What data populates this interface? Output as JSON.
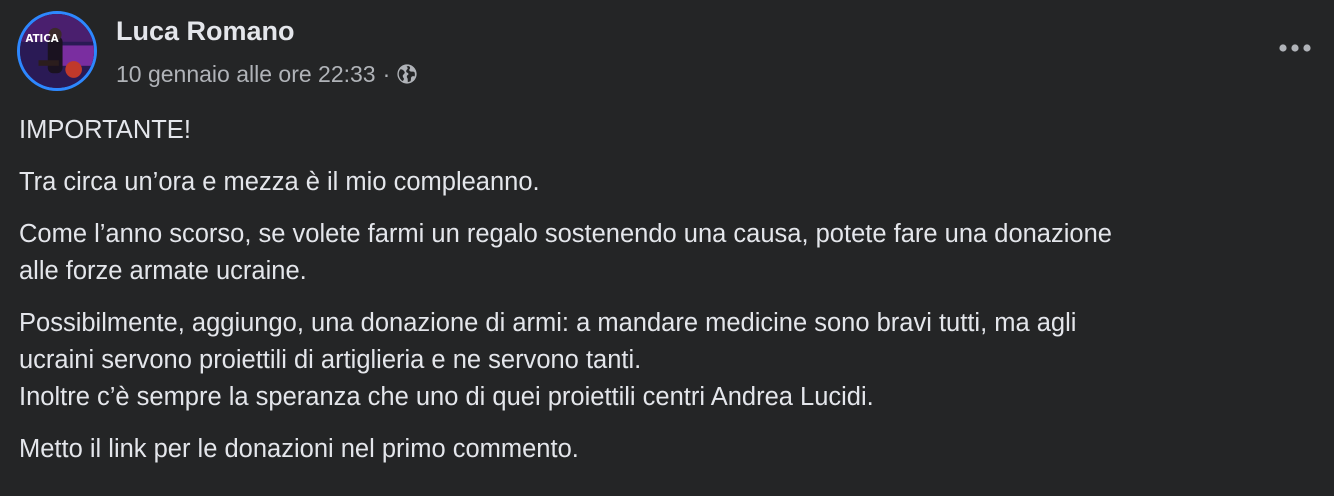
{
  "post": {
    "author_name": "Luca Romano",
    "timestamp": "10 gennaio alle ore 22:33",
    "separator": "·",
    "privacy_icon": "globe-icon",
    "more_icon": "more-options-icon",
    "avatar_text": "ATICA",
    "paragraphs": [
      {
        "lines": [
          "IMPORTANTE!"
        ]
      },
      {
        "lines": [
          "Tra circa un’ora e mezza è il mio compleanno."
        ]
      },
      {
        "lines": [
          "Come l’anno scorso, se volete farmi un regalo sostenendo una causa, potete fare una donazione",
          "alle forze armate ucraine."
        ]
      },
      {
        "lines": [
          "Possibilmente, aggiungo, una donazione di armi: a mandare medicine sono bravi tutti, ma agli",
          "ucraini servono proiettili di artiglieria e ne servono tanti.",
          "Inoltre c’è sempre la speranza che uno di quei proiettili centri Andrea Lucidi."
        ]
      },
      {
        "lines": [
          "Metto il link per le donazioni nel primo commento."
        ]
      }
    ]
  },
  "colors": {
    "background": "#242526",
    "primary_text": "#e4e6eb",
    "secondary_text": "#b0b3b8",
    "avatar_ring": "#2d88ff"
  }
}
